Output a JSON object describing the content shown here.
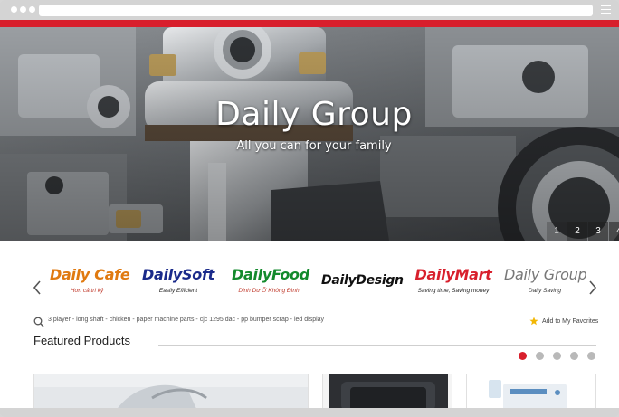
{
  "hero": {
    "title": "Daily Group",
    "subtitle": "All you can for your family",
    "slides": [
      "1",
      "2",
      "3",
      "4"
    ],
    "active_slide": "1"
  },
  "brands": [
    {
      "name": "Daily Cafe",
      "tagline": "Hơn cả tri kỷ",
      "color": "#e07a10",
      "tagline_color": "#c0392b"
    },
    {
      "name": "DailySoft",
      "tagline": "Easily Efficient",
      "color": "#1a2a8a",
      "tagline_color": "#222222"
    },
    {
      "name": "DailyFood",
      "tagline": "Dinh Dư Ỡ Không Đình",
      "color": "#138a2c",
      "tagline_color": "#c0392b"
    },
    {
      "name": "DailyDesign",
      "tagline": "",
      "color": "#111111",
      "tagline_color": "#222222"
    },
    {
      "name": "DailyMart",
      "tagline": "Saving time, Saving money",
      "color": "#d81f2c",
      "tagline_color": "#222222"
    },
    {
      "name": "Daily Group",
      "tagline": "Daily Saving",
      "color": "#777777",
      "tagline_color": "#333333"
    }
  ],
  "search": {
    "keywords": "3 player - long shaft - chicken - paper machine parts - cjc 1295 dac - pp bumper scrap - led display"
  },
  "favorites": {
    "label": "Add to My Favorites"
  },
  "featured": {
    "title": "Featured Products",
    "pages": 5,
    "active_page": 1
  },
  "colors": {
    "accent": "#d81f2c",
    "star": "#f2b705"
  },
  "icons": {
    "search": "search-icon",
    "star": "star-icon",
    "prev": "chevron-left-icon",
    "next": "chevron-right-icon",
    "menu": "hamburger-icon"
  }
}
